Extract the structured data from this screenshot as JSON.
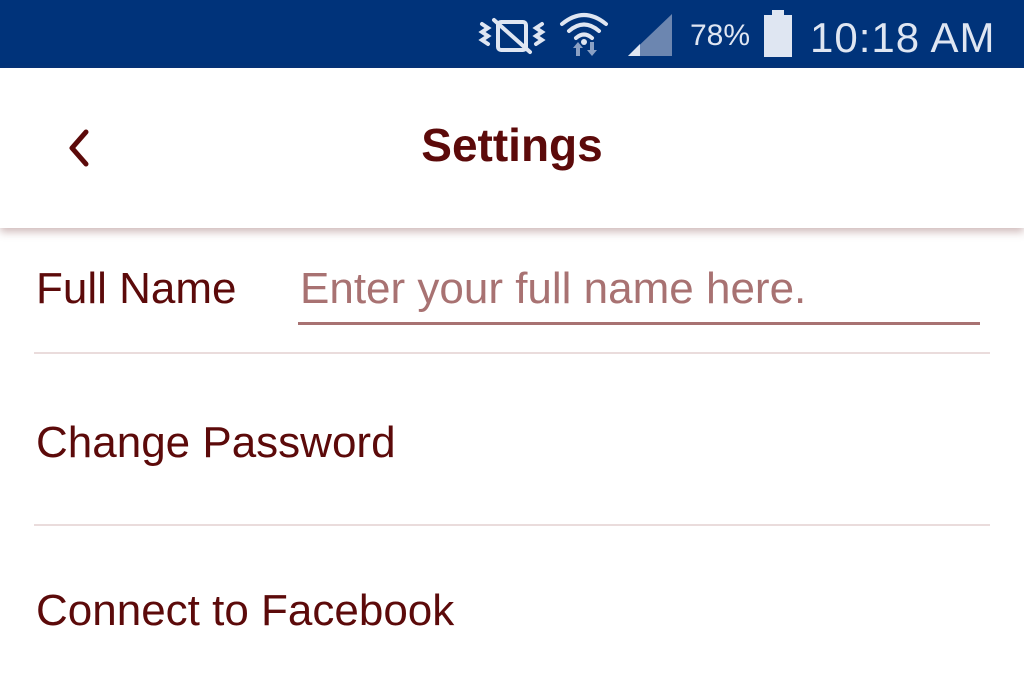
{
  "status_bar": {
    "battery_percent": "78%",
    "time": "10:18 AM",
    "icons": [
      "vibrate-muted-icon",
      "wifi-icon",
      "cell-signal-icon",
      "battery-icon"
    ]
  },
  "app_bar": {
    "title": "Settings",
    "back_icon": "chevron-left-icon"
  },
  "settings": {
    "full_name": {
      "label": "Full Name",
      "value": "",
      "placeholder": "Enter your full name here."
    },
    "change_password": {
      "label": "Change Password"
    },
    "connect_facebook": {
      "label": "Connect to Facebook"
    }
  },
  "colors": {
    "status_bar_bg": "#00337a",
    "text_primary": "#5c0a0a",
    "placeholder": "#a87272",
    "divider": "#eadcdc"
  }
}
